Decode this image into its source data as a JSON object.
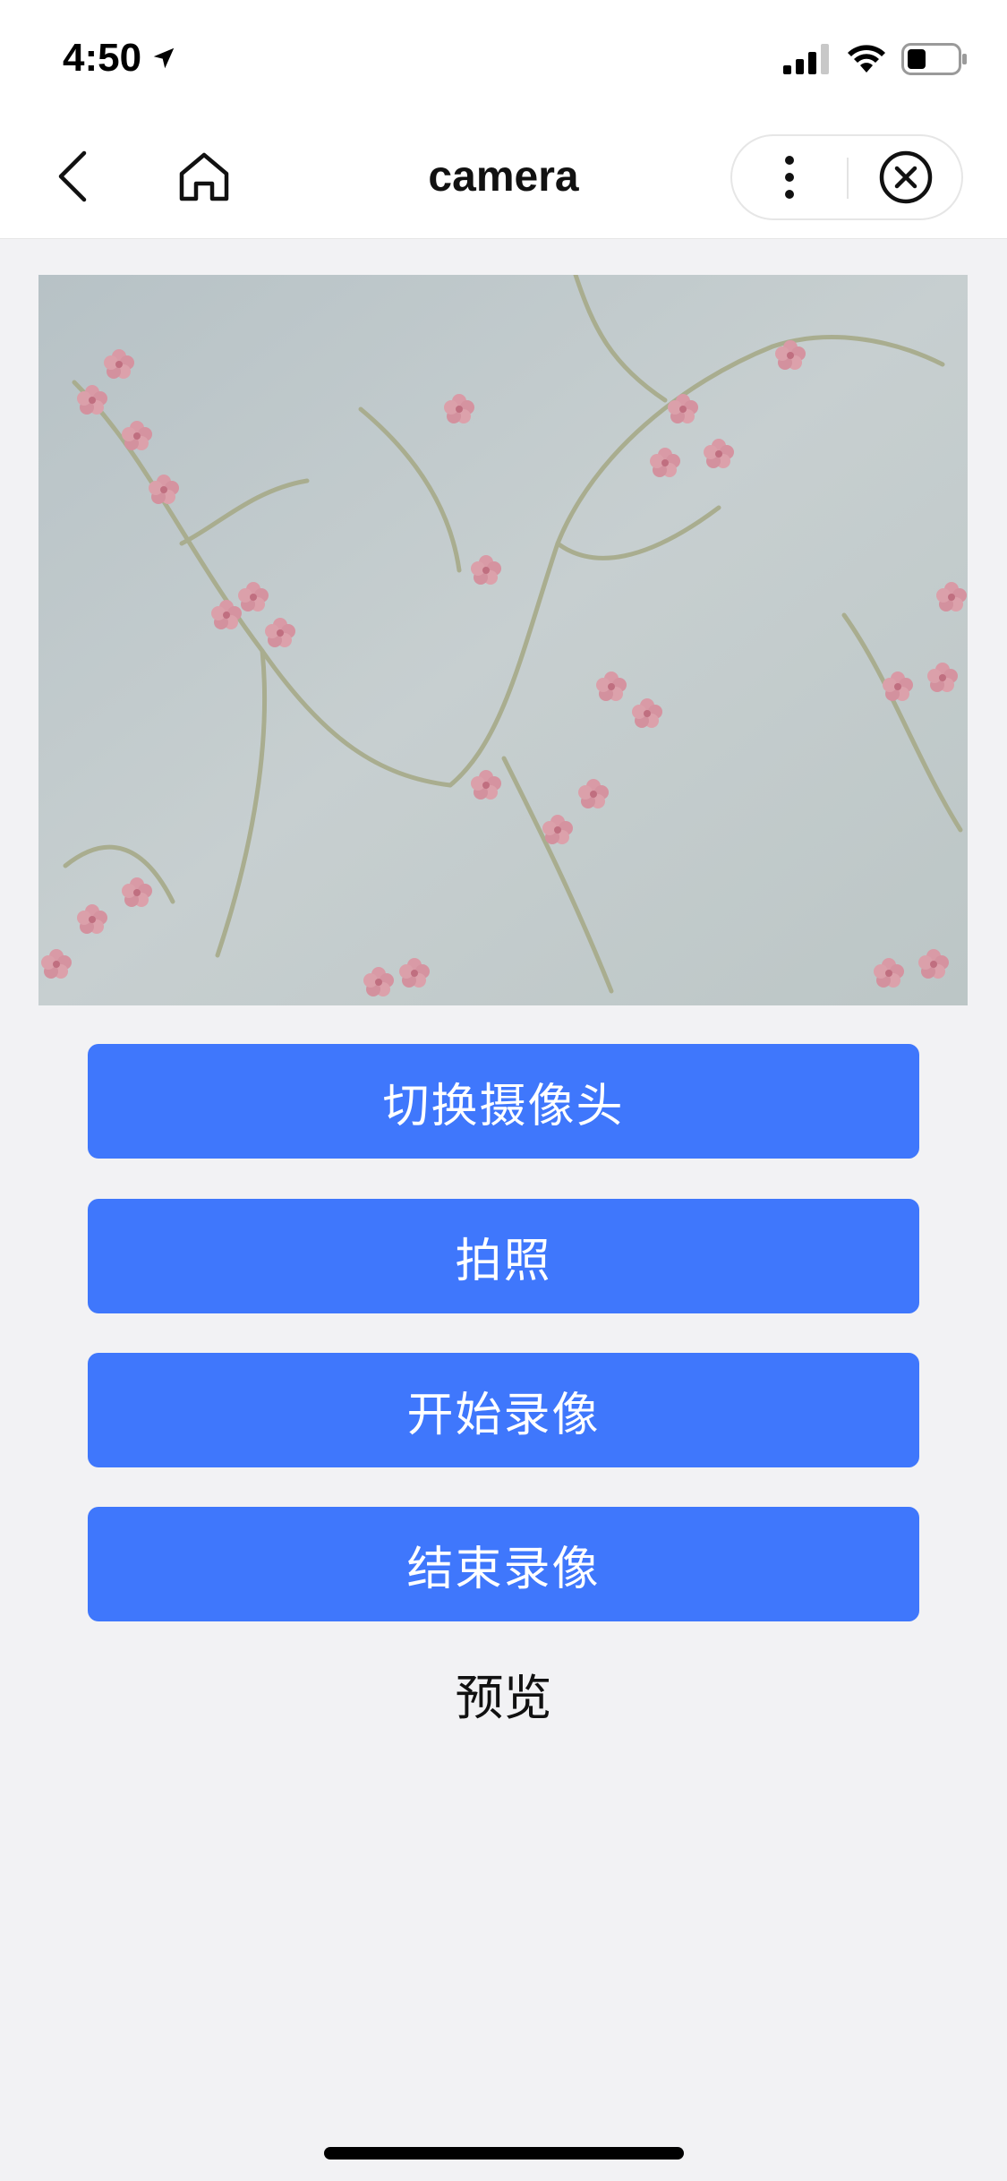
{
  "status_bar": {
    "time": "4:50"
  },
  "nav": {
    "title": "camera"
  },
  "buttons": {
    "switch_camera": "切换摄像头",
    "take_photo": "拍照",
    "start_recording": "开始录像",
    "stop_recording": "结束录像"
  },
  "preview_label": "预览",
  "colors": {
    "primary_button": "#3f77fc",
    "page_background": "#f2f2f4",
    "navbar_background": "#ffffff"
  },
  "icons": {
    "back": "chevron-left-icon",
    "home": "home-icon",
    "more": "more-vertical-icon",
    "close": "close-circle-icon",
    "location": "location-arrow-icon",
    "signal": "cellular-signal-icon",
    "wifi": "wifi-icon",
    "battery": "battery-icon"
  }
}
